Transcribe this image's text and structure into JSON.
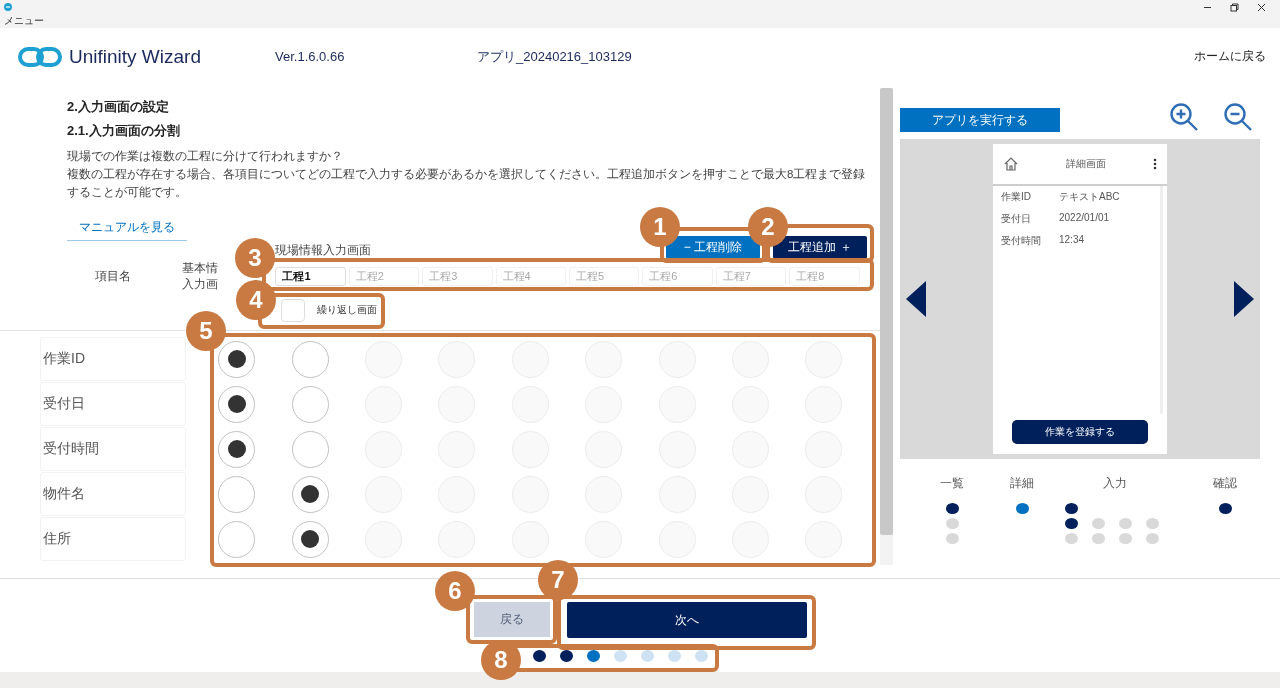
{
  "window": {
    "menu": "メニュー"
  },
  "header": {
    "brand": "Unifinity Wizard",
    "version": "Ver.1.6.0.66",
    "app_name": "アプリ_20240216_103129",
    "home_link": "ホームに戻る"
  },
  "section": {
    "title": "2.入力画面の設定",
    "subtitle": "2.1.入力画面の分割",
    "paragraphs": [
      "現場での作業は複数の工程に分けて行われますか？",
      "複数の工程が存在する場合、各項目についてどの工程で入力する必要があるかを選択してください。工程追加ボタンを押すことで最大8工程まで登録することが可能です。"
    ],
    "manual_link": "マニュアルを見る"
  },
  "process_header": {
    "column_label": "項目名",
    "basic_lines": [
      "基本情",
      "入力画"
    ],
    "group_label": "現場情報入力画面",
    "remove_button": "− 工程削除",
    "add_button": "工程追加 ＋",
    "tabs": [
      {
        "label": "工程1",
        "selected": true
      },
      {
        "label": "工程2",
        "selected": false
      },
      {
        "label": "工程3",
        "selected": false
      },
      {
        "label": "工程4",
        "selected": false
      },
      {
        "label": "工程5",
        "selected": false
      },
      {
        "label": "工程6",
        "selected": false
      },
      {
        "label": "工程7",
        "selected": false
      },
      {
        "label": "工程8",
        "selected": false
      }
    ],
    "repeat": {
      "label": "繰り返し画面",
      "checked": false
    }
  },
  "items": [
    {
      "label": "作業ID",
      "options": [
        {
          "selected": true,
          "disabled": false
        },
        {
          "selected": false,
          "disabled": false
        },
        {
          "selected": false,
          "disabled": true
        },
        {
          "selected": false,
          "disabled": true
        },
        {
          "selected": false,
          "disabled": true
        },
        {
          "selected": false,
          "disabled": true
        },
        {
          "selected": false,
          "disabled": true
        },
        {
          "selected": false,
          "disabled": true
        },
        {
          "selected": false,
          "disabled": true
        }
      ]
    },
    {
      "label": "受付日",
      "options": [
        {
          "selected": true,
          "disabled": false
        },
        {
          "selected": false,
          "disabled": false
        },
        {
          "selected": false,
          "disabled": true
        },
        {
          "selected": false,
          "disabled": true
        },
        {
          "selected": false,
          "disabled": true
        },
        {
          "selected": false,
          "disabled": true
        },
        {
          "selected": false,
          "disabled": true
        },
        {
          "selected": false,
          "disabled": true
        },
        {
          "selected": false,
          "disabled": true
        }
      ]
    },
    {
      "label": "受付時間",
      "options": [
        {
          "selected": true,
          "disabled": false
        },
        {
          "selected": false,
          "disabled": false
        },
        {
          "selected": false,
          "disabled": true
        },
        {
          "selected": false,
          "disabled": true
        },
        {
          "selected": false,
          "disabled": true
        },
        {
          "selected": false,
          "disabled": true
        },
        {
          "selected": false,
          "disabled": true
        },
        {
          "selected": false,
          "disabled": true
        },
        {
          "selected": false,
          "disabled": true
        }
      ]
    },
    {
      "label": "物件名",
      "options": [
        {
          "selected": false,
          "disabled": false
        },
        {
          "selected": true,
          "disabled": false
        },
        {
          "selected": false,
          "disabled": true
        },
        {
          "selected": false,
          "disabled": true
        },
        {
          "selected": false,
          "disabled": true
        },
        {
          "selected": false,
          "disabled": true
        },
        {
          "selected": false,
          "disabled": true
        },
        {
          "selected": false,
          "disabled": true
        },
        {
          "selected": false,
          "disabled": true
        }
      ]
    },
    {
      "label": "住所",
      "options": [
        {
          "selected": false,
          "disabled": false
        },
        {
          "selected": true,
          "disabled": false
        },
        {
          "selected": false,
          "disabled": true
        },
        {
          "selected": false,
          "disabled": true
        },
        {
          "selected": false,
          "disabled": true
        },
        {
          "selected": false,
          "disabled": true
        },
        {
          "selected": false,
          "disabled": true
        },
        {
          "selected": false,
          "disabled": true
        },
        {
          "selected": false,
          "disabled": true
        }
      ]
    }
  ],
  "preview": {
    "run_button": "アプリを実行する",
    "screen_title": "詳細画面",
    "fields": [
      {
        "label": "作業ID",
        "value": "テキストABC"
      },
      {
        "label": "受付日",
        "value": "2022/01/01"
      },
      {
        "label": "受付時間",
        "value": "12:34"
      }
    ],
    "submit": "作業を登録する"
  },
  "flow": [
    {
      "label": "一覧",
      "rows": [
        [
          {
            "color": "#00205b"
          }
        ],
        [
          {
            "color": "#d9d9d9"
          }
        ],
        [
          {
            "color": "#d9d9d9"
          }
        ]
      ]
    },
    {
      "label": "詳細",
      "rows": [
        [
          {
            "color": "#0070c0"
          }
        ]
      ]
    },
    {
      "label": "入力",
      "rows": [
        [
          {
            "color": "#00205b"
          }
        ],
        [
          {
            "color": "#00205b"
          },
          {
            "color": "#d9d9d9"
          },
          {
            "color": "#d9d9d9"
          },
          {
            "color": "#d9d9d9"
          }
        ],
        [
          {
            "color": "#d9d9d9"
          },
          {
            "color": "#d9d9d9"
          },
          {
            "color": "#d9d9d9"
          },
          {
            "color": "#d9d9d9"
          }
        ]
      ]
    },
    {
      "label": "確認",
      "rows": [
        [
          {
            "color": "#00205b"
          }
        ]
      ]
    }
  ],
  "footer": {
    "back": {
      "label": "戻る",
      "disabled": true
    },
    "next": {
      "label": "次へ"
    },
    "pages": [
      {
        "color": "#00205b"
      },
      {
        "color": "#00205b"
      },
      {
        "color": "#0070c0"
      },
      {
        "color": "#cfe2f3"
      },
      {
        "color": "#cfe2f3"
      },
      {
        "color": "#cfe2f3"
      },
      {
        "color": "#cfe2f3"
      }
    ]
  },
  "callouts": [
    {
      "number": "1"
    },
    {
      "number": "2"
    },
    {
      "number": "3"
    },
    {
      "number": "4"
    },
    {
      "number": "5"
    },
    {
      "number": "6"
    },
    {
      "number": "7"
    },
    {
      "number": "8"
    }
  ]
}
